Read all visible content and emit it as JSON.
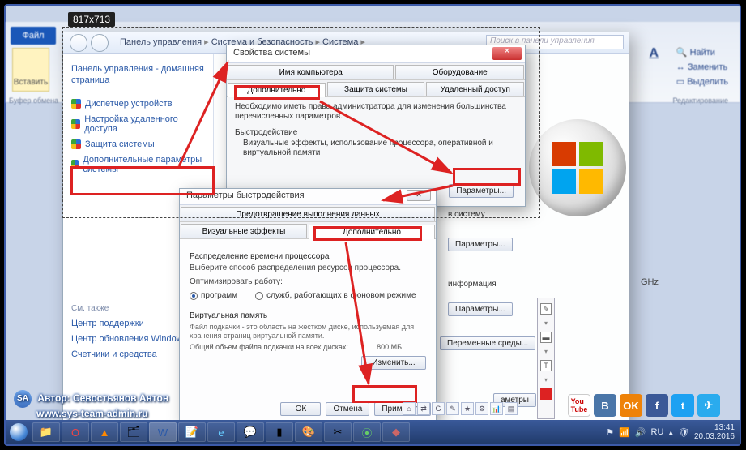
{
  "dim_badge": "817x713",
  "ribbon": {
    "file": "Файл",
    "paste": "Вставить",
    "clipboard_label": "Буфер обмена",
    "find": "Найти",
    "replace": "Заменить",
    "select": "Выделить",
    "editing_label": "Редактирование"
  },
  "explorer": {
    "breadcrumbs": [
      "Панель управления",
      "Система и безопасность",
      "Система"
    ],
    "search_placeholder": "Поиск в панели управления",
    "sidebar": {
      "home": "Панель управления - домашняя страница",
      "links": [
        "Диспетчер устройств",
        "Настройка удаленного доступа",
        "Защита системы",
        "Дополнительные параметры системы"
      ],
      "see_also": "См. также",
      "extras": [
        "Центр поддержки",
        "Центр обновления Windows",
        "Счетчики и средства"
      ]
    }
  },
  "sysprops": {
    "title": "Свойства системы",
    "tabs_row1": [
      "Имя компьютера",
      "Оборудование"
    ],
    "tabs_row2": [
      "Дополнительно",
      "Защита системы",
      "Удаленный доступ"
    ],
    "note": "Необходимо иметь права администратора для изменения большинства перечисленных параметров.",
    "perf_group": "Быстродействие",
    "perf_desc": "Визуальные эффекты, использование процессора, оперативной и виртуальной памяти",
    "params_btn": "Параметры..."
  },
  "perfopts": {
    "title": "Параметры быстродействия",
    "tabs_top": "Предотвращение выполнения данных",
    "tabs_row": [
      "Визуальные эффекты",
      "Дополнительно"
    ],
    "sched_head": "Распределение времени процессора",
    "sched_sub": "Выберите способ распределения ресурсов процессора.",
    "opt_label": "Оптимизировать работу:",
    "opt_programs": "программ",
    "opt_services": "служб, работающих в фоновом режиме",
    "vm_head": "Виртуальная память",
    "vm_desc": "Файл подкачки - это область на жестком диске, используемая для хранения страниц виртуальной памяти.",
    "vm_total_label": "Общий объем файла подкачки на всех дисках:",
    "vm_total_value": "800 МБ",
    "change_btn": "Изменить...",
    "ok_btn": "ОК",
    "cancel_btn": "Отмена",
    "apply_btn": "Применить"
  },
  "stray": {
    "login_label": "в систему",
    "info_label": "информация",
    "params_btn": "Параметры...",
    "env_btn": "Переменные среды...",
    "extra_btn": "аметры"
  },
  "ghz": "GHz",
  "watermark": {
    "line1": "Автор: Севостьянов Антон",
    "line2": "www.sys-team-admin.ru",
    "badge": "SA"
  },
  "taskbar": {
    "lang": "RU",
    "time": "13:41",
    "date": "20.03.2016"
  },
  "socials": [
    "YouTube",
    "ВКонтакте",
    "Одноклассники",
    "Facebook",
    "Twitter",
    "Telegram"
  ]
}
